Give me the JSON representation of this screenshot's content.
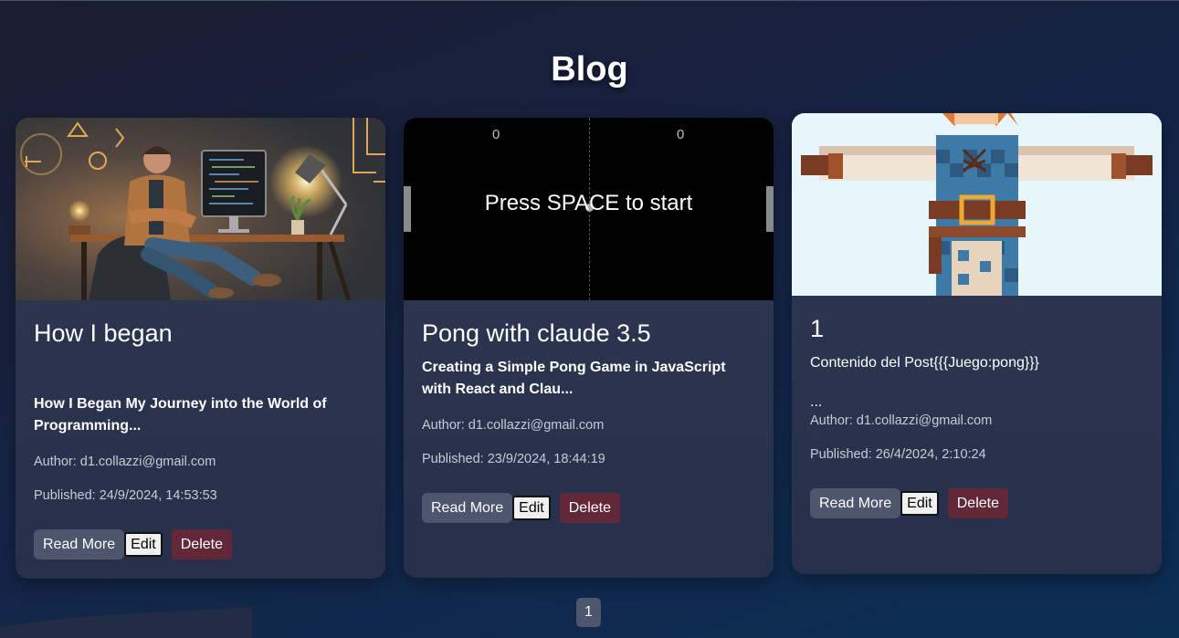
{
  "page": {
    "title": "Blog"
  },
  "posts": [
    {
      "title": "How I began",
      "excerpt": "How I Began My Journey into the World of Programming...",
      "author": "Author: d1.collazzi@gmail.com",
      "published": "Published: 24/9/2024, 14:53:53",
      "image": "illustration of a man sitting at a desk with a computer and lamp"
    },
    {
      "title": "Pong with claude 3.5",
      "excerpt": "Creating a Simple Pong Game in JavaScript with React and Clau...",
      "author": "Author: d1.collazzi@gmail.com",
      "published": "Published: 23/9/2024, 18:44:19",
      "image": "pong game screen",
      "pong": {
        "score_left": "0",
        "score_right": "0",
        "prompt": "Press SPACE to start"
      }
    },
    {
      "title": "1",
      "excerpt": "Contenido del Post{{{Juego:pong}}}",
      "excerpt_more": "...",
      "author": "Author: d1.collazzi@gmail.com",
      "published": "Published: 26/4/2024, 2:10:24",
      "image": "pixel art character in T-pose"
    }
  ],
  "actions": {
    "read_more": "Read More",
    "edit": "Edit",
    "delete": "Delete"
  },
  "pagination": {
    "current": "1"
  },
  "colors": {
    "background_start": "#1b1d31",
    "background_end": "#0b2e55",
    "card": "#2f3854",
    "read_more_button": "#4d566d",
    "delete_button": "#622739"
  }
}
